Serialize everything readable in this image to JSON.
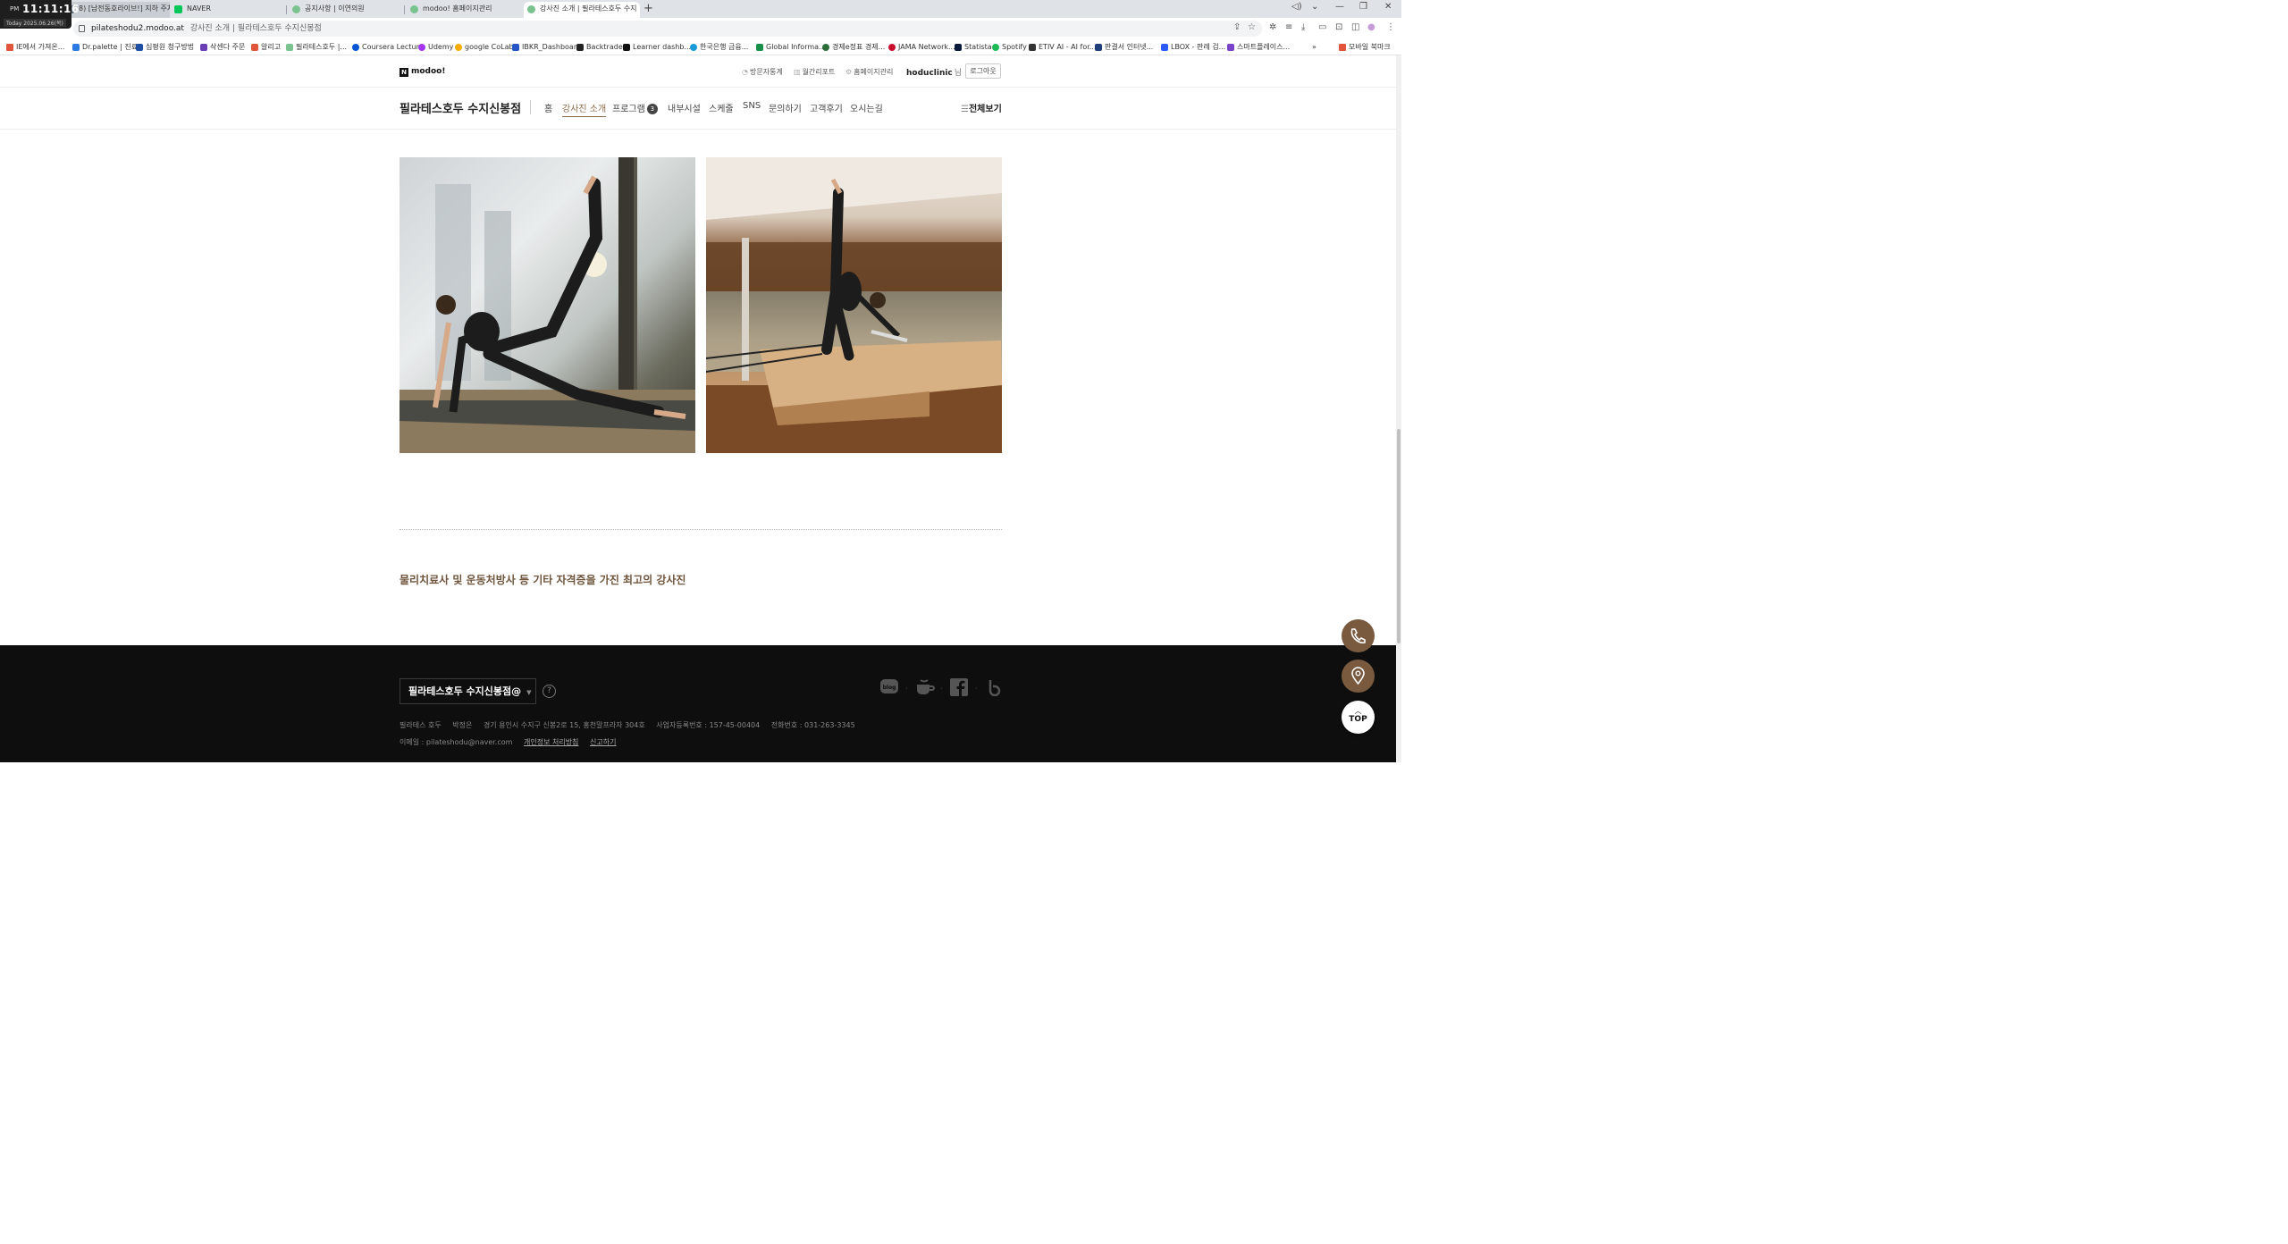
{
  "clock": {
    "ampm": "PM",
    "time": "11:11:16",
    "date": "Today 2025.06.26(목)"
  },
  "browser": {
    "tabs": [
      {
        "label": "8) [남전동호라이브!] 지하 주차",
        "color": "#5f6b7a"
      },
      {
        "label": "NAVER",
        "color": "#03c75a"
      },
      {
        "label": "공지사항 | 이연의원",
        "color": "#7ac38f"
      },
      {
        "label": "modoo! 홈페이지관리",
        "color": "#7ac38f"
      },
      {
        "label": "강사진 소개 | 필라테스호두 수지",
        "color": "#7ac38f"
      }
    ],
    "new_tab": "+",
    "url_domain": "pilateshodu2.modoo.at",
    "url_title": "강사진 소개 | 필라테스호두 수지신봉점",
    "bookmarks": [
      {
        "label": "IE에서 가져온...",
        "folder": true
      },
      {
        "label": "Dr.palette | 진료",
        "color": "#2c7be5"
      },
      {
        "label": "심평원 청구방법",
        "color": "#1e4fa3"
      },
      {
        "label": "삭센다 주문",
        "color": "#6a3fb5"
      },
      {
        "label": "알리고",
        "color": "#e0553c"
      },
      {
        "label": "필라테스호두 |...",
        "color": "#7ac38f"
      },
      {
        "label": "Coursera Lecture",
        "color": "#0056d2"
      },
      {
        "label": "Udemy",
        "color": "#a435f0"
      },
      {
        "label": "google CoLab",
        "color": "#f9ab00"
      },
      {
        "label": "IBKR_Dashboard",
        "color": "#2456c5"
      },
      {
        "label": "Backtrader",
        "color": "#222222"
      },
      {
        "label": "Learner dashb...",
        "color": "#111111"
      },
      {
        "label": "한국은행 금융...",
        "color": "#1b9bd7"
      },
      {
        "label": "Global Informa...",
        "color": "#1a8f4a"
      },
      {
        "label": "경제e정표 경제...",
        "color": "#2b6e3a"
      },
      {
        "label": "JAMA Network...",
        "color": "#c8102e"
      },
      {
        "label": "Statista",
        "color": "#0a1a3a"
      },
      {
        "label": "Spotify",
        "color": "#1db954"
      },
      {
        "label": "ETIV AI - AI for...",
        "color": "#333333"
      },
      {
        "label": "판결서 인터넷...",
        "color": "#1e3f7a"
      },
      {
        "label": "LBOX - 판례 검...",
        "color": "#2e5bff"
      },
      {
        "label": "스마트플레이스...",
        "color": "#7a42c8"
      }
    ],
    "bookmark_more": "»",
    "mobile_bookmarks": "모바일 북마크"
  },
  "site": {
    "logo": "modoo!",
    "top_links": [
      "방문자통계",
      "월간리포트",
      "홈페이지관리"
    ],
    "user": "hoduclinic",
    "user_suffix": "님",
    "logout": "로그아웃",
    "name": "필라테스호두 수지신봉점",
    "nav": [
      {
        "label": "홈"
      },
      {
        "label": "강사진 소개",
        "active": true
      },
      {
        "label": "프로그램",
        "badge": "3"
      },
      {
        "label": "내부시설"
      },
      {
        "label": "스케줄"
      },
      {
        "label": "SNS"
      },
      {
        "label": "문의하기"
      },
      {
        "label": "고객후기"
      },
      {
        "label": "오시는길"
      }
    ],
    "all_view": "전체보기"
  },
  "content": {
    "caption": "물리치료사 및 운동처방사 등 기타 자격증을 가진 최고의 강사진"
  },
  "footer": {
    "select": "필라테스호두 수지신봉점@",
    "help": "?",
    "info": [
      "필라테스 호두",
      "박정은",
      "경기 용인시 수지구 신봉2로 15, 홍천말프라자 304호",
      "사업자등록번호 : 157-45-00404",
      "전화번호 : 031-263-3345"
    ],
    "email": "이메일 : pilateshodu@naver.com",
    "privacy": "개인정보 처리방침",
    "report": "신고하기",
    "sns_blog": "blog"
  },
  "floating": {
    "top": "TOP"
  },
  "colors": {
    "accent": "#7a5a3e",
    "footer_bg": "#0e0e0e",
    "caption": "#6f553c"
  }
}
